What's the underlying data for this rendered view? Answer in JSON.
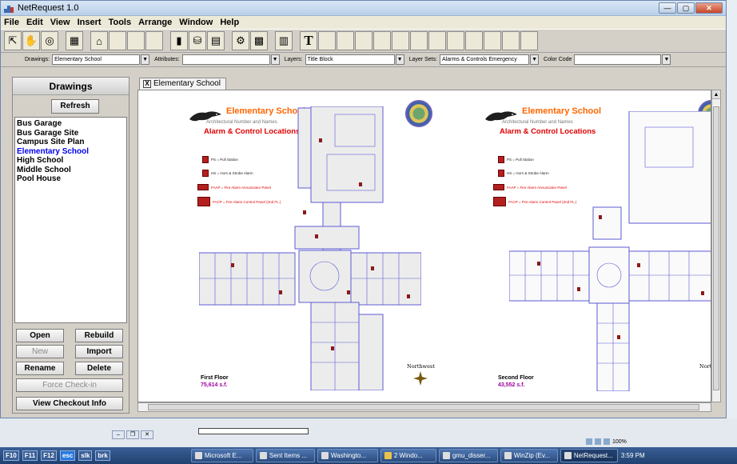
{
  "app": {
    "title": "NetRequest 1.0",
    "window_buttons": [
      "—",
      "▢",
      "✕"
    ]
  },
  "menu": [
    "File",
    "Edit",
    "View",
    "Insert",
    "Tools",
    "Arrange",
    "Window",
    "Help"
  ],
  "attrbar": {
    "drawings_label": "Drawings:",
    "drawings_value": "Elementary School",
    "attributes_label": "Attributes:",
    "attributes_value": "",
    "layers_label": "Layers:",
    "layers_value": "Title Block",
    "layer_sets_label": "Layer Sets:",
    "layer_sets_value": "Alarms & Controls Emergency",
    "color_code_label": "Color Code",
    "color_code_value": ""
  },
  "left_panel": {
    "title": "Drawings",
    "refresh": "Refresh",
    "items": [
      "Bus Garage",
      "Bus Garage Site",
      "Campus Site Plan",
      "Elementary School",
      "High School",
      "Middle School",
      "Pool House"
    ],
    "selected_index": 3,
    "buttons": {
      "open": "Open",
      "rebuild": "Rebuild",
      "new": "New",
      "import": "Import",
      "rename": "Rename",
      "delete": "Delete",
      "force_checkin": "Force Check-in",
      "view_checkout": "View Checkout Info"
    }
  },
  "document": {
    "tab_close": "X",
    "tab_label": "Elementary School",
    "sheets": [
      {
        "title": "Elementary School",
        "subtitle": "Architectural Number and Names",
        "alarm": "Alarm & Control Locations",
        "legend": [
          "PS = Pull Station",
          "HS = Horn & Strobe Alarm",
          "FAAP = Fire Alarm Annunciator Panel",
          "FACP = Fire Alarm Control Panel (2nd FL.)"
        ],
        "floor": "First Floor",
        "area": "75,614 s.f.",
        "north": "Northwest"
      },
      {
        "title": "Elementary School",
        "subtitle": "Architectural Number and Names",
        "alarm": "Alarm & Control Locations",
        "legend": [
          "PS = Pull Station",
          "HS = Horn & Strobe Alarm",
          "FAAP = Fire Alarm Annunciator Panel",
          "FACP = Fire Alarm Control Panel (2nd FL.)"
        ],
        "floor": "Second Floor",
        "area": "43,552 s.f.",
        "north": "Nort"
      }
    ]
  },
  "background": {
    "zoom": "100%"
  },
  "taskbar": {
    "fkeys": [
      "F10",
      "F11",
      "F12",
      "esc",
      "slk",
      "brk"
    ],
    "tasks": [
      "Microsoft E...",
      "Sent Items ...",
      "Washingto...",
      "2 Windo...",
      "gmu_disser...",
      "WinZip (Ev...",
      "NetRequest..."
    ],
    "clock": "3:59 PM"
  }
}
